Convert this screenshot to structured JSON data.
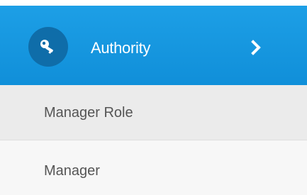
{
  "menu": {
    "header": {
      "label": "Authority",
      "icon": "key-icon",
      "expand_icon": "chevron-right-icon",
      "background": "#1a9be3",
      "icon_background": "#0f6da9"
    },
    "items": [
      {
        "label": "Manager Role"
      },
      {
        "label": "Manager"
      }
    ]
  }
}
